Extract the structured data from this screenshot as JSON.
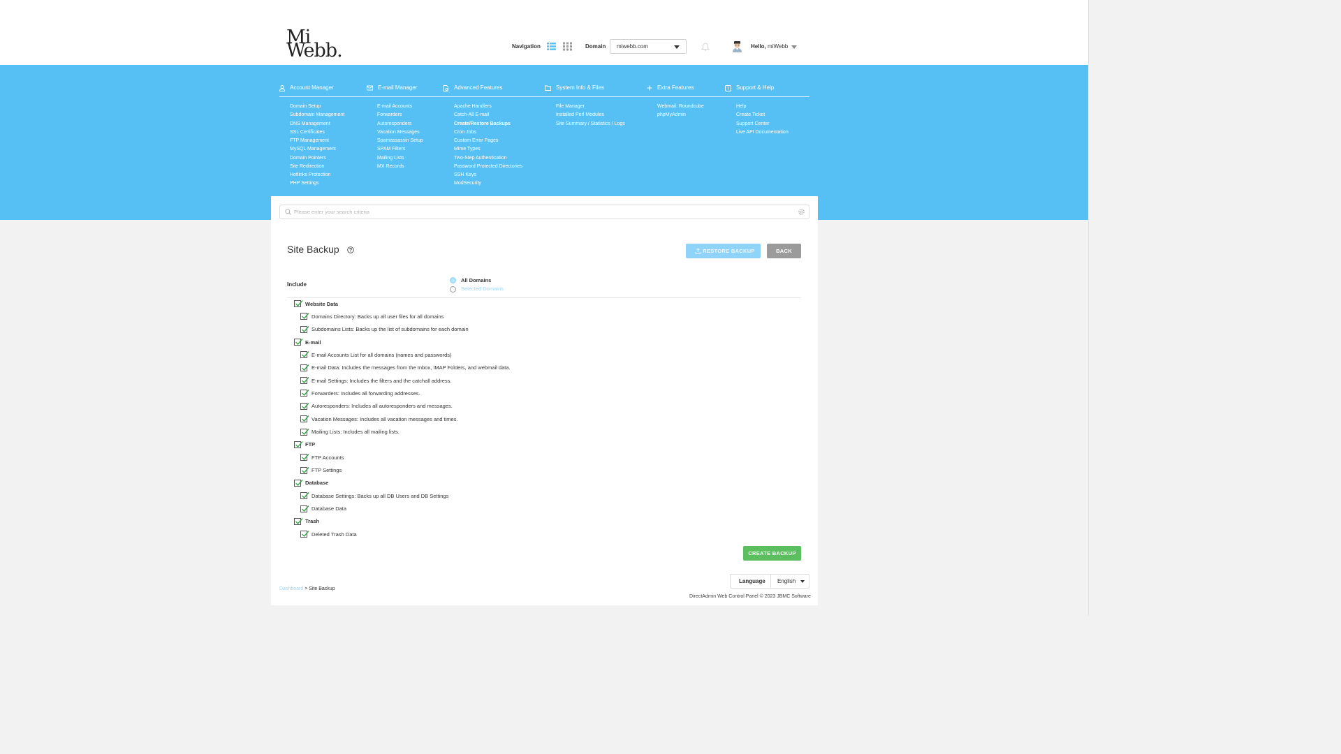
{
  "header": {
    "logo_line1": "Mi",
    "logo_line2": "Webb.",
    "navigation_label": "Navigation",
    "domain_label": "Domain",
    "domain_value": "miwebb.com",
    "hello_prefix": "Hello,",
    "user_name": "miWebb"
  },
  "menu": {
    "columns": [
      {
        "title": "Account Manager",
        "icon": "user-icon",
        "items": [
          "Domain Setup",
          "Subdomain Management",
          "DNS Management",
          "SSL Certificates",
          "FTP Management",
          "MySQL Management",
          "Domain Pointers",
          "Site Redirection",
          "Hotlinks Protection",
          "PHP Settings"
        ]
      },
      {
        "title": "E-mail Manager",
        "icon": "envelope-icon",
        "items": [
          "E-mail Accounts",
          "Forwarders",
          "Autoresponders",
          "Vacation Messages",
          "Spamassassin Setup",
          "SPAM Filters",
          "Mailing Lists",
          "MX Records"
        ]
      },
      {
        "title": "Advanced Features",
        "icon": "gear-document-icon",
        "items": [
          "Apache Handlers",
          "Catch-All E-mail",
          "Create/Restore Backups",
          "Cron Jobs",
          "Custom Error Pages",
          "Mime Types",
          "Two-Step Authentication",
          "Password Protected Directories",
          "SSH Keys",
          "ModSecurity"
        ]
      },
      {
        "title": "System Info & Files",
        "icon": "folder-icon",
        "items": [
          "File Manager",
          "Installed Perl Modules",
          "Site Summary / Statistics / Logs"
        ]
      },
      {
        "title": "Extra Features",
        "icon": "plus-icon",
        "items": [
          "Webmail: Roundcube",
          "phpMyAdmin"
        ]
      },
      {
        "title": "Support & Help",
        "icon": "info-icon",
        "items": [
          "Help",
          "Create Ticket",
          "Support Center",
          "Live API Documentation"
        ]
      }
    ],
    "active_item": "Create/Restore Backups"
  },
  "search": {
    "placeholder": "Please enter your search criteria"
  },
  "page": {
    "title": "Site Backup",
    "restore_button": "RESTORE BACKUP",
    "back_button": "BACK",
    "create_button": "CREATE BACKUP",
    "include_label": "Include",
    "radio_all": "All Domains",
    "radio_selected": "Selected Domains",
    "groups": [
      {
        "label": "Website Data",
        "items": [
          "Domains Directory: Backs up all user files for all domains",
          "Subdomains Lists: Backs up the list of subdomains for each domain"
        ]
      },
      {
        "label": "E-mail",
        "items": [
          "E-mail Accounts List for all domains (names and passwords)",
          "E-mail Data: Includes the messages from the Inbox, IMAP Folders, and webmail data.",
          "E-mail Settings: Includes the filters and the catchall address.",
          "Forwarders: Includes all forwarding addresses.",
          "Autoresponders: Includes all autoresponders and messages.",
          "Vacation Messages: Includes all vacation messages and times.",
          "Mailing Lists: Includes all mailing lists."
        ]
      },
      {
        "label": "FTP",
        "items": [
          "FTP Accounts",
          "FTP Settings"
        ]
      },
      {
        "label": "Database",
        "items": [
          "Database Settings: Backs up all DB Users and DB Settings",
          "Database Data"
        ]
      },
      {
        "label": "Trash",
        "items": [
          "Deleted Trash Data"
        ]
      }
    ]
  },
  "footer": {
    "language_label": "Language",
    "language_value": "English",
    "breadcrumb_link": "Dashboard",
    "breadcrumb_current": "> Site Backup",
    "copyright": "DirectAdmin Web Control Panel © 2023 JBMC Software"
  },
  "colors": {
    "accent_blue": "#56c0f5",
    "create_green": "#5cbf5f",
    "back_grey": "#9b9b9b"
  }
}
